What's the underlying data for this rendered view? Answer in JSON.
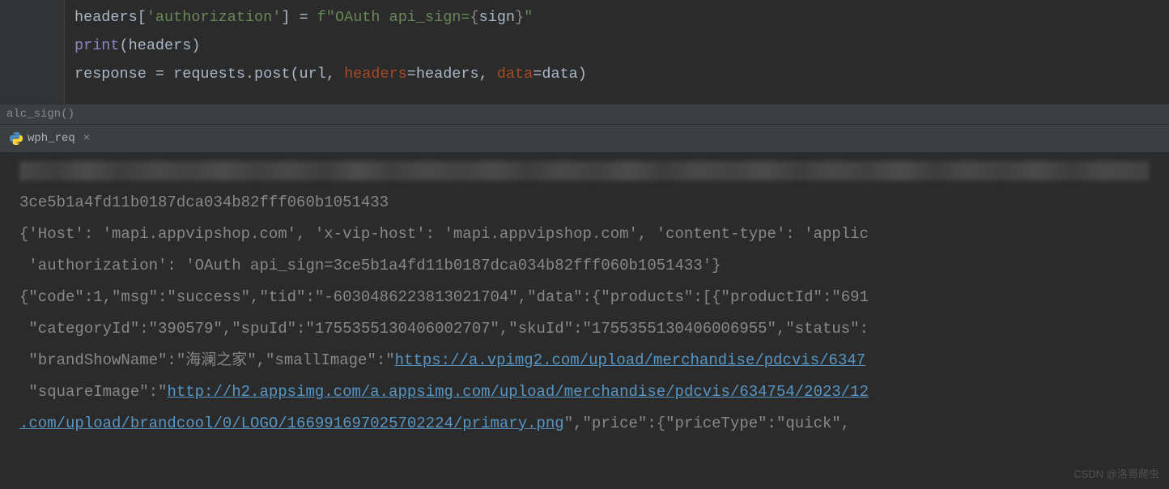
{
  "code": {
    "line1": {
      "p1": "headers[",
      "p2": "'authorization'",
      "p3": "] = ",
      "p4": "f\"OAuth api_sign=",
      "p5": "{",
      "p6": "sign",
      "p7": "}",
      "p8": "\""
    },
    "line2": {
      "p1": "print",
      "p2": "(headers)"
    },
    "line3": {
      "p1": "response = requests.post(url",
      "p2": ", ",
      "p3": "headers",
      "p4": "=headers",
      "p5": ", ",
      "p6": "data",
      "p7": "=data)"
    }
  },
  "breadcrumb": "alc_sign()",
  "tab": {
    "name": "wph_req"
  },
  "console": {
    "l1": "3ce5b1a4fd11b0187dca034b82fff060b1051433",
    "l2": "{'Host': 'mapi.appvipshop.com', 'x-vip-host': 'mapi.appvipshop.com', 'content-type': 'applic",
    "l3": " 'authorization': 'OAuth api_sign=3ce5b1a4fd11b0187dca034b82fff060b1051433'}",
    "l4": "{\"code\":1,\"msg\":\"success\",\"tid\":\"-6030486223813021704\",\"data\":{\"products\":[{\"productId\":\"691",
    "l5": " \"categoryId\":\"390579\",\"spuId\":\"1755355130406002707\",\"skuId\":\"1755355130406006955\",\"status\":",
    "l6a": " \"brandShowName\":\"海澜之家\",\"smallImage\":\"",
    "l6b": "https://a.vpimg2.com/upload/merchandise/pdcvis/6347",
    "l7a": " \"squareImage\":\"",
    "l7b": "http://h2.appsimg.com/a.appsimg.com/upload/merchandise/pdcvis/634754/2023/12",
    "l8a": ".com/upload/brandcool/0/LOGO/166991697025702224/primary.png",
    "l8b": "\",\"price\":{\"priceType\":\"quick\","
  },
  "watermark": "CSDN @洛哥爬虫"
}
